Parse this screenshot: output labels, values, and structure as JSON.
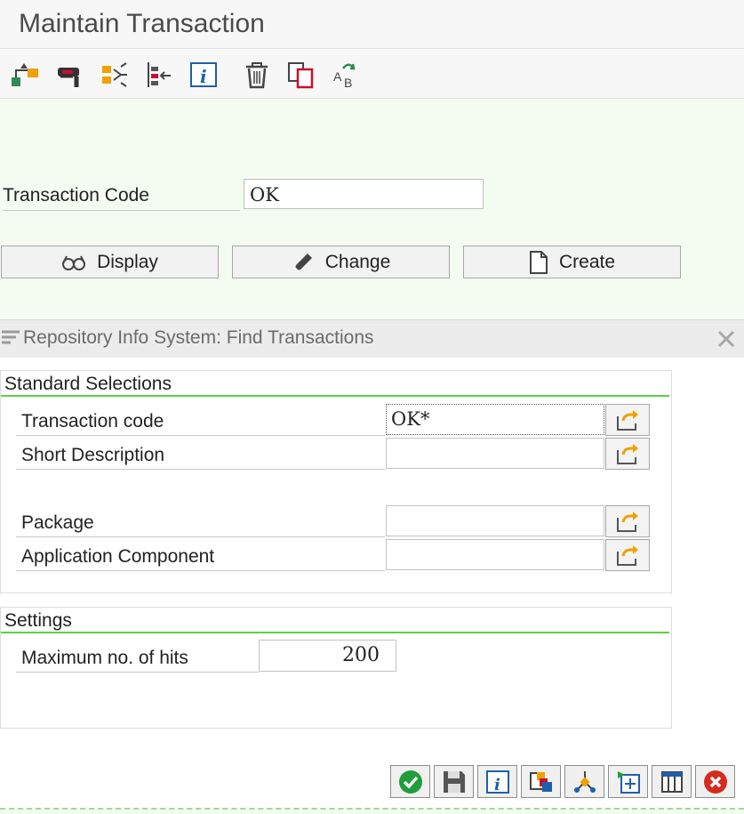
{
  "window": {
    "title": "Maintain Transaction"
  },
  "toolbar": {
    "icons": [
      "object-hierarchy-icon",
      "where-used-icon",
      "navigation-icon",
      "structure-icon",
      "info-icon",
      "delete-icon",
      "copy-icon",
      "rename-icon"
    ],
    "accent_red": "#c8102e",
    "accent_green": "#2e8b57"
  },
  "transaction": {
    "label": "Transaction Code",
    "value": "OK"
  },
  "actions": {
    "display_label": "Display",
    "change_label": "Change",
    "create_label": "Create"
  },
  "dialog": {
    "title": "Repository Info System: Find Transactions",
    "standard": {
      "title": "Standard Selections",
      "fields": [
        {
          "label": "Transaction code",
          "value": "OK*"
        },
        {
          "label": "Short Description",
          "value": ""
        },
        {
          "label": "Package",
          "value": ""
        },
        {
          "label": "Application Component",
          "value": ""
        }
      ]
    },
    "settings": {
      "title": "Settings",
      "max_hits_label": "Maximum no. of hits",
      "max_hits_value": "200"
    },
    "group_line_color": "#5fcf45",
    "footer_buttons": [
      "execute-icon",
      "save-icon",
      "info-icon",
      "multiple-selection-icon",
      "split-icon",
      "add-icon",
      "layout-icon",
      "cancel-icon"
    ]
  },
  "colors": {
    "main_background": "#f4fbf1",
    "execute_green": "#1f9e3a",
    "cancel_red": "#d52b1e",
    "selection_arrow": "#f0a000"
  }
}
